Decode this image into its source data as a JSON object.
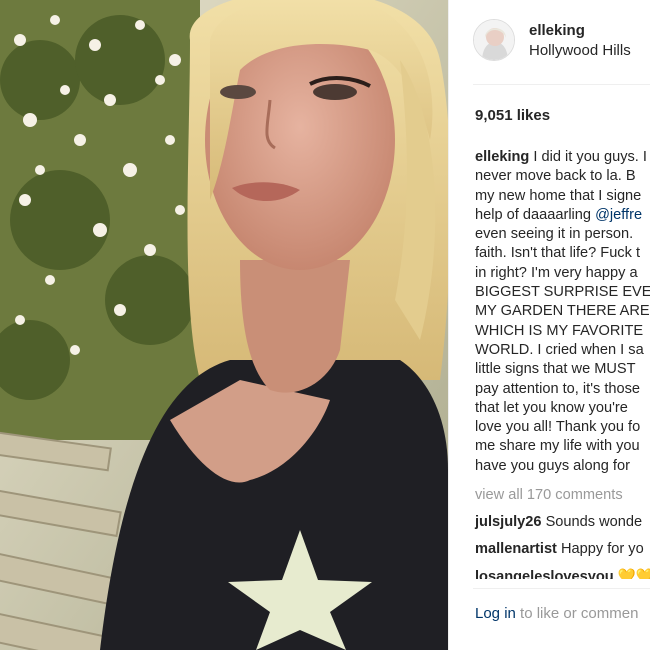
{
  "post": {
    "username": "elleking",
    "location": "Hollywood Hills",
    "likes": "9,051 likes",
    "caption_user": "elleking",
    "caption_lines": [
      "I did it you guys. I",
      "never move back to la. B",
      "my new home that I signe",
      "help of daaaarling",
      "even seeing it in person.",
      "faith. Isn't that life? Fuck t",
      "in right? I'm very happy a",
      "BIGGEST SURPRISE EVE",
      "MY GARDEN THERE ARE",
      "WHICH IS MY FAVORITE",
      "WORLD. I cried when I sa",
      "little signs that we MUST",
      "pay attention to, it's those",
      "that let you know you're",
      "love you all! Thank you fo",
      "me share my life with you",
      "have you guys along for"
    ],
    "mention": "@jeffre",
    "view_all": "view all 170 comments",
    "comments": [
      {
        "user": "julsjuly26",
        "text": "Sounds wonde"
      },
      {
        "user": "mallenartist",
        "text": "Happy for yo"
      },
      {
        "user": "losangeleslovesyou",
        "text": "💛💛"
      }
    ],
    "login_link": "Log in",
    "login_rest": " to like or commen"
  },
  "colors": {
    "text": "#262626",
    "muted": "#999999",
    "link": "#003569"
  },
  "icons": [
    "avatar-image"
  ]
}
